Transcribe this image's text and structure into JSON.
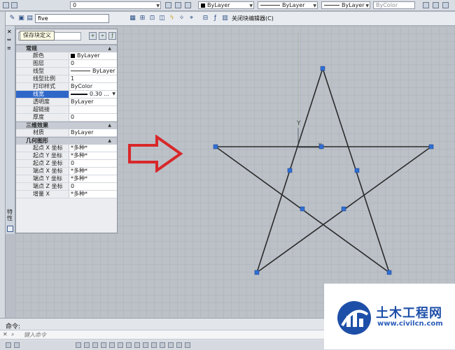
{
  "top_toolbar": {
    "color_value": "ByLayer",
    "linetype_value": "ByLayer",
    "lineweight_value": "ByLayer",
    "plotstyle_value": "ByColor",
    "layer_value": "0"
  },
  "block_toolbar": {
    "block_name": "five",
    "close_label": "关闭块编辑器(C)"
  },
  "tooltip": {
    "text": "保存块定义"
  },
  "side_label": "特性",
  "properties": {
    "sections": [
      {
        "title": "常规",
        "rows": [
          {
            "key": "颜色",
            "value": "ByLayer",
            "kind": "color"
          },
          {
            "key": "图层",
            "value": "0"
          },
          {
            "key": "线型",
            "value": "ByLayer",
            "kind": "line"
          },
          {
            "key": "线型比例",
            "value": "1"
          },
          {
            "key": "打印样式",
            "value": "ByColor"
          },
          {
            "key": "线宽",
            "value": "0.30 ...",
            "kind": "lineweight",
            "selected": true
          },
          {
            "key": "透明度",
            "value": "ByLayer"
          },
          {
            "key": "超链接",
            "value": ""
          },
          {
            "key": "厚度",
            "value": "0"
          }
        ]
      },
      {
        "title": "三维效果",
        "rows": [
          {
            "key": "材质",
            "value": "ByLayer"
          }
        ]
      },
      {
        "title": "几何图形",
        "rows": [
          {
            "key": "起点 X 坐标",
            "value": "*多种*"
          },
          {
            "key": "起点 Y 坐标",
            "value": "*多种*"
          },
          {
            "key": "起点 Z 坐标",
            "value": "0"
          },
          {
            "key": "端点 X 坐标",
            "value": "*多种*"
          },
          {
            "key": "端点 Y 坐标",
            "value": "*多种*"
          },
          {
            "key": "端点 Z 坐标",
            "value": "0"
          },
          {
            "key": "增量 X",
            "value": "*多种*"
          }
        ]
      }
    ]
  },
  "ucs": {
    "y_label": "Y",
    "x_label": "X"
  },
  "command": {
    "prompt": "命令:",
    "placeholder": "键入命令"
  },
  "watermark": {
    "title": "土木工程网",
    "url": "www.civilcn.com"
  },
  "colors": {
    "grip": "#2f6fd6",
    "selected_row": "#2f67c9",
    "arrow": "#d8282a",
    "star_line": "#2a2a2a"
  }
}
